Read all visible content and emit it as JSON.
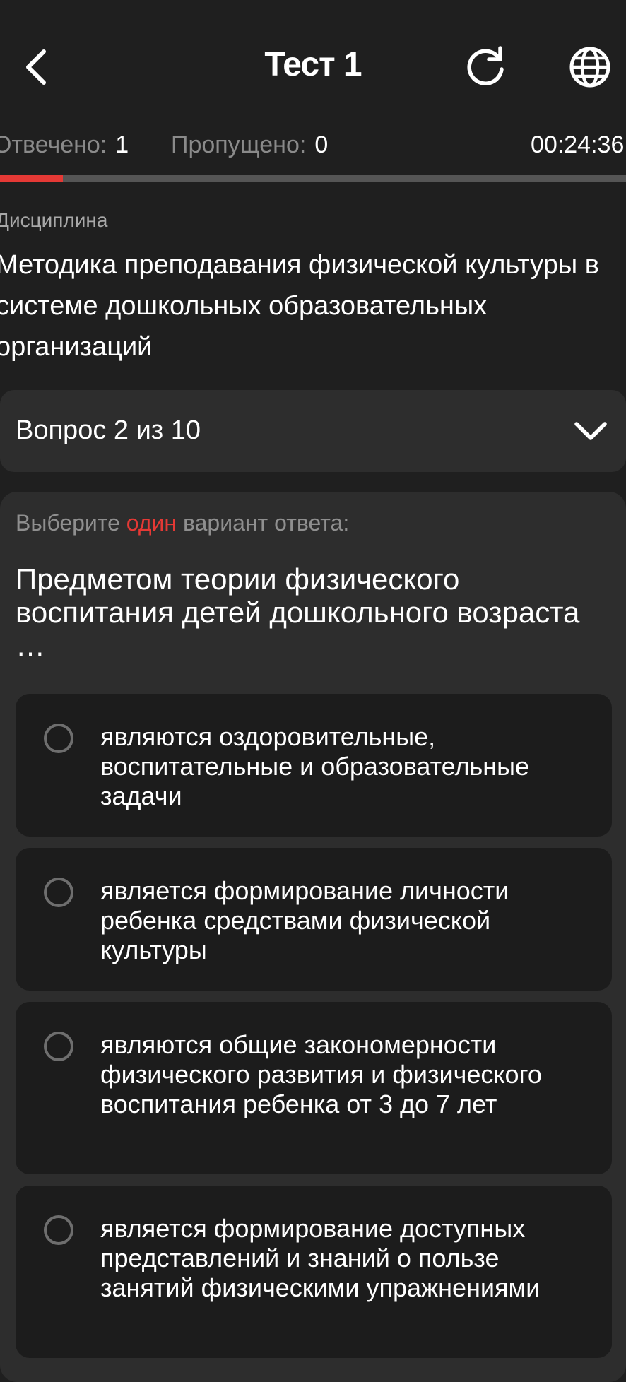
{
  "header": {
    "title": "Тест 1",
    "back_icon": "chevron-left-icon",
    "refresh_icon": "refresh-icon",
    "language_icon": "globe-icon"
  },
  "stats": {
    "answered_label": "Отвечено:",
    "answered_value": "1",
    "skipped_label": "Пропущено:",
    "skipped_value": "0",
    "timer": "00:24:36"
  },
  "progress": {
    "fraction": 0.1,
    "fill_color": "#e53935",
    "track_color": "#555555"
  },
  "discipline": {
    "label": "Дисциплина",
    "name": "Методика преподавания физической культуры в системе дошкольных образовательных организаций"
  },
  "question_selector": {
    "label": "Вопрос 2 из 10",
    "chevron_icon": "chevron-down-icon"
  },
  "question": {
    "instruction_prefix": "Выберите",
    "instruction_accent": "один",
    "instruction_suffix": "вариант ответа:",
    "text": "Предметом теории физического воспитания детей дошкольного возраста …",
    "options": [
      {
        "text": "являются оздоровительные, воспитательные и образовательные задачи",
        "selected": false
      },
      {
        "text": "является формирование личности ребенка средствами физической культуры",
        "selected": false
      },
      {
        "text": "являются общие закономерности физического развития и физического воспитания ребенка от 3 до 7 лет",
        "selected": false
      },
      {
        "text": "является формирование доступных представлений и знаний о пользе занятий физическими упражнениями",
        "selected": false
      }
    ]
  },
  "colors": {
    "background": "#1f1f1f",
    "card": "#2d2d2d",
    "option_bg": "#1c1c1c",
    "accent": "#e53935"
  }
}
